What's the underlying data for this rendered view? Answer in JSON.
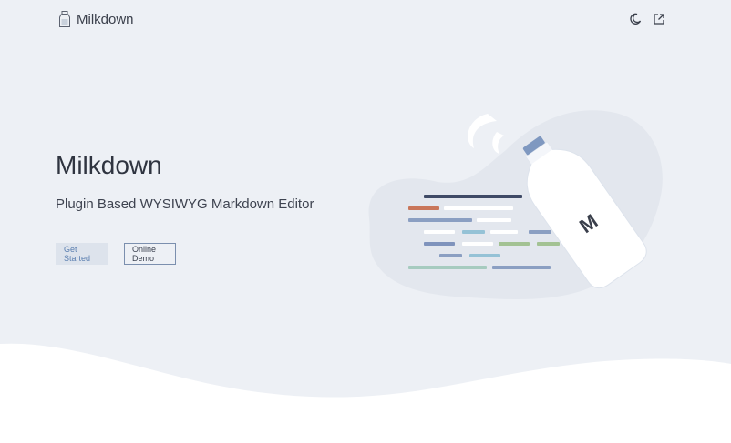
{
  "app": {
    "name": "Milkdown"
  },
  "nav": {
    "icons": [
      "moon-icon",
      "external-link-icon"
    ]
  },
  "hero": {
    "title": "Milkdown",
    "subtitle": "Plugin Based WYSIWYG Markdown Editor",
    "primary_button": "Get Started",
    "secondary_button": "Online Demo"
  },
  "illustration": {
    "bottle_letter": "M"
  },
  "colors": {
    "background": "#edf0f5",
    "accent": "#5b7fb0",
    "blob": "#e3e7ee",
    "wave": "#ffffff"
  }
}
